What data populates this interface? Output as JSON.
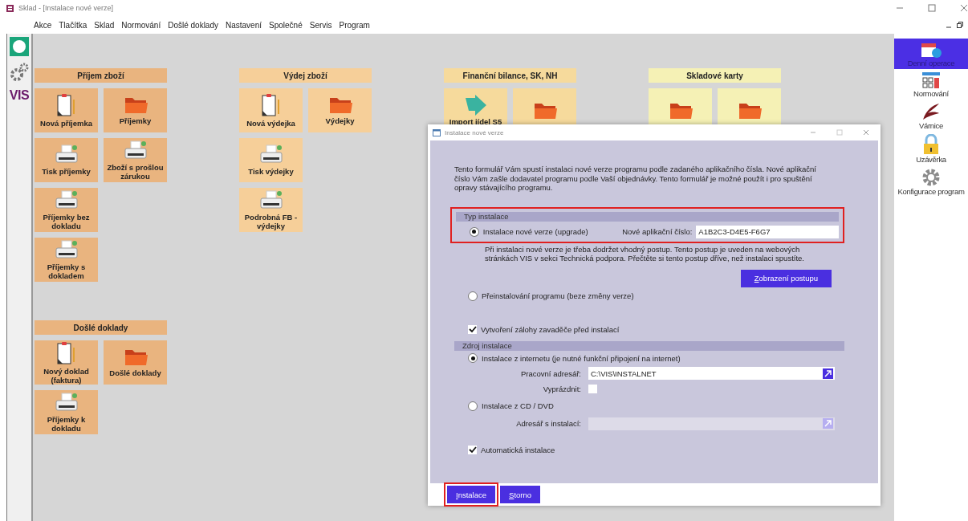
{
  "window": {
    "title": "Sklad - [Instalace nové verze]"
  },
  "menu": [
    "Akce",
    "Tlačítka",
    "Sklad",
    "Normování",
    "Došlé doklady",
    "Nastavení",
    "Společné",
    "Servis",
    "Program"
  ],
  "left_strip": {
    "logo": "VIS"
  },
  "columns": [
    {
      "groups": [
        {
          "title": "Příjem zboží",
          "color": "#e9b47f",
          "rows": [
            [
              {
                "label": "Nová příjemka",
                "kind": "clipboard"
              },
              {
                "label": "Příjemky",
                "kind": "folder"
              }
            ],
            [
              {
                "label": "Tisk příjemky",
                "kind": "printer"
              },
              {
                "label": "Zboží s prošlou zárukou",
                "kind": "printer"
              }
            ],
            [
              {
                "label": "Příjemky bez dokladu",
                "kind": "printer"
              }
            ],
            [
              {
                "label": "Příjemky s dokladem",
                "kind": "printer"
              }
            ]
          ]
        },
        {
          "title": "Došlé doklady",
          "color": "#e9b47f",
          "rows": [
            [
              {
                "label": "Nový doklad (faktura)",
                "kind": "clipboard"
              },
              {
                "label": "Došlé doklady",
                "kind": "folder"
              }
            ],
            [
              {
                "label": "Příjemky k dokladu",
                "kind": "printer"
              }
            ]
          ]
        }
      ]
    },
    {
      "groups": [
        {
          "title": "Výdej zboží",
          "color": "#f6cf99",
          "rows": [
            [
              {
                "label": "Nová výdejka",
                "kind": "clipboard"
              },
              {
                "label": "Výdejky",
                "kind": "folder"
              }
            ],
            [
              {
                "label": "Tisk výdejky",
                "kind": "printer"
              }
            ],
            [
              {
                "label": "Podrobná FB - výdejky",
                "kind": "printer"
              }
            ]
          ]
        }
      ]
    },
    {
      "groups": [
        {
          "title": "Finanční bilance, SK, NH",
          "color": "#f6da9c",
          "rows": [
            [
              {
                "label": "Import jídel S5",
                "kind": "arrow"
              },
              {
                "kind": "folder"
              }
            ]
          ]
        }
      ]
    },
    {
      "groups": [
        {
          "title": "Skladové karty",
          "color": "#f5f1b5",
          "rows": [
            [
              {
                "kind": "folder"
              },
              {
                "kind": "folder"
              }
            ]
          ]
        }
      ]
    }
  ],
  "right_panel": [
    {
      "label": "Denní operace",
      "kind": "calendar",
      "selected": true
    },
    {
      "label": "Normování",
      "kind": "calculator",
      "selected": false
    },
    {
      "label": "Várnice",
      "kind": "feather",
      "selected": false
    },
    {
      "label": "Uzávěrka",
      "kind": "lock",
      "selected": false
    },
    {
      "label": "Konfigurace program",
      "kind": "gear",
      "selected": false
    }
  ],
  "dialog": {
    "title": "Instalace nové verze",
    "intro": "Tento formulář Vám spustí instalaci nové verze programu podle zadaného aplikačního čísla. Nové aplikační číslo Vám zašle dodavatel programu podle Vaší objednávky. Tento formulář je možné použít i pro spuštění opravy stávajícího programu.",
    "type_section": {
      "title": "Typ instalace",
      "highlighted": true,
      "upgrade": {
        "label": "Instalace nové verze (upgrade)",
        "selected": true
      },
      "app_number": {
        "label": "Nové aplikační číslo:",
        "value": "A1B2C3-D4E5-F6G7"
      },
      "note": "Při instalaci nové verze je třeba dodržet vhodný postup. Tento postup je uveden na webových stránkách VIS v sekci Technická podpora. Přečtěte si tento postup dříve, než instalaci spustíte.",
      "procedure_button": "Zobrazení postupu",
      "reinstall": {
        "label": "Přeinstalování programu (beze změny verze)",
        "selected": false
      }
    },
    "backup": {
      "label": "Vytvoření zálohy zavaděče před instalací",
      "checked": true
    },
    "source_section": {
      "title": "Zdroj instalace",
      "internet": {
        "label": "Instalace z internetu (je nutné funkční připojení na internet)",
        "selected": true
      },
      "work_dir": {
        "label": "Pracovní adresář:",
        "value": "C:\\VIS\\INSTALNET",
        "disabled": false
      },
      "clear": {
        "label": "Vyprázdnit:",
        "checked": false
      },
      "cd": {
        "label": "Instalace z CD / DVD",
        "selected": false
      },
      "install_dir": {
        "label": "Adresář s instalací:",
        "disabled": true
      }
    },
    "auto": {
      "label": "Automatická instalace",
      "checked": true
    },
    "buttons": [
      {
        "label": "Instalace",
        "highlighted": true
      },
      {
        "label": "Storno",
        "highlighted": false
      }
    ]
  }
}
